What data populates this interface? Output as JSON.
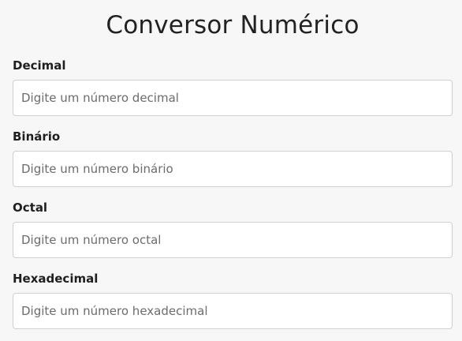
{
  "header": {
    "title": "Conversor Numérico"
  },
  "fields": [
    {
      "label": "Decimal",
      "value": "",
      "placeholder": "Digite um número decimal"
    },
    {
      "label": "Binário",
      "value": "",
      "placeholder": "Digite um número binário"
    },
    {
      "label": "Octal",
      "value": "",
      "placeholder": "Digite um número octal"
    },
    {
      "label": "Hexadecimal",
      "value": "",
      "placeholder": "Digite um número hexadecimal"
    }
  ],
  "colors": {
    "background": "#f7f7f7",
    "text": "#222222",
    "input_border": "#cfcfcf",
    "placeholder": "#6c6c6c"
  }
}
